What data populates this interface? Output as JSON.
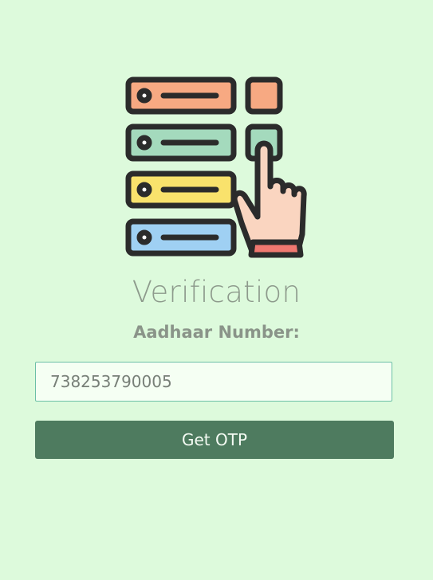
{
  "illustration": {
    "icon": "server-select-hand-icon",
    "colors": [
      "#f7a982",
      "#a4dabd",
      "#f9e26c",
      "#9fd0f3",
      "#fad5c0",
      "#f07870"
    ]
  },
  "page": {
    "title": "Verification"
  },
  "form": {
    "label": "Aadhaar Number:",
    "aadhaar_value": "738253790005",
    "button_label": "Get OTP"
  }
}
